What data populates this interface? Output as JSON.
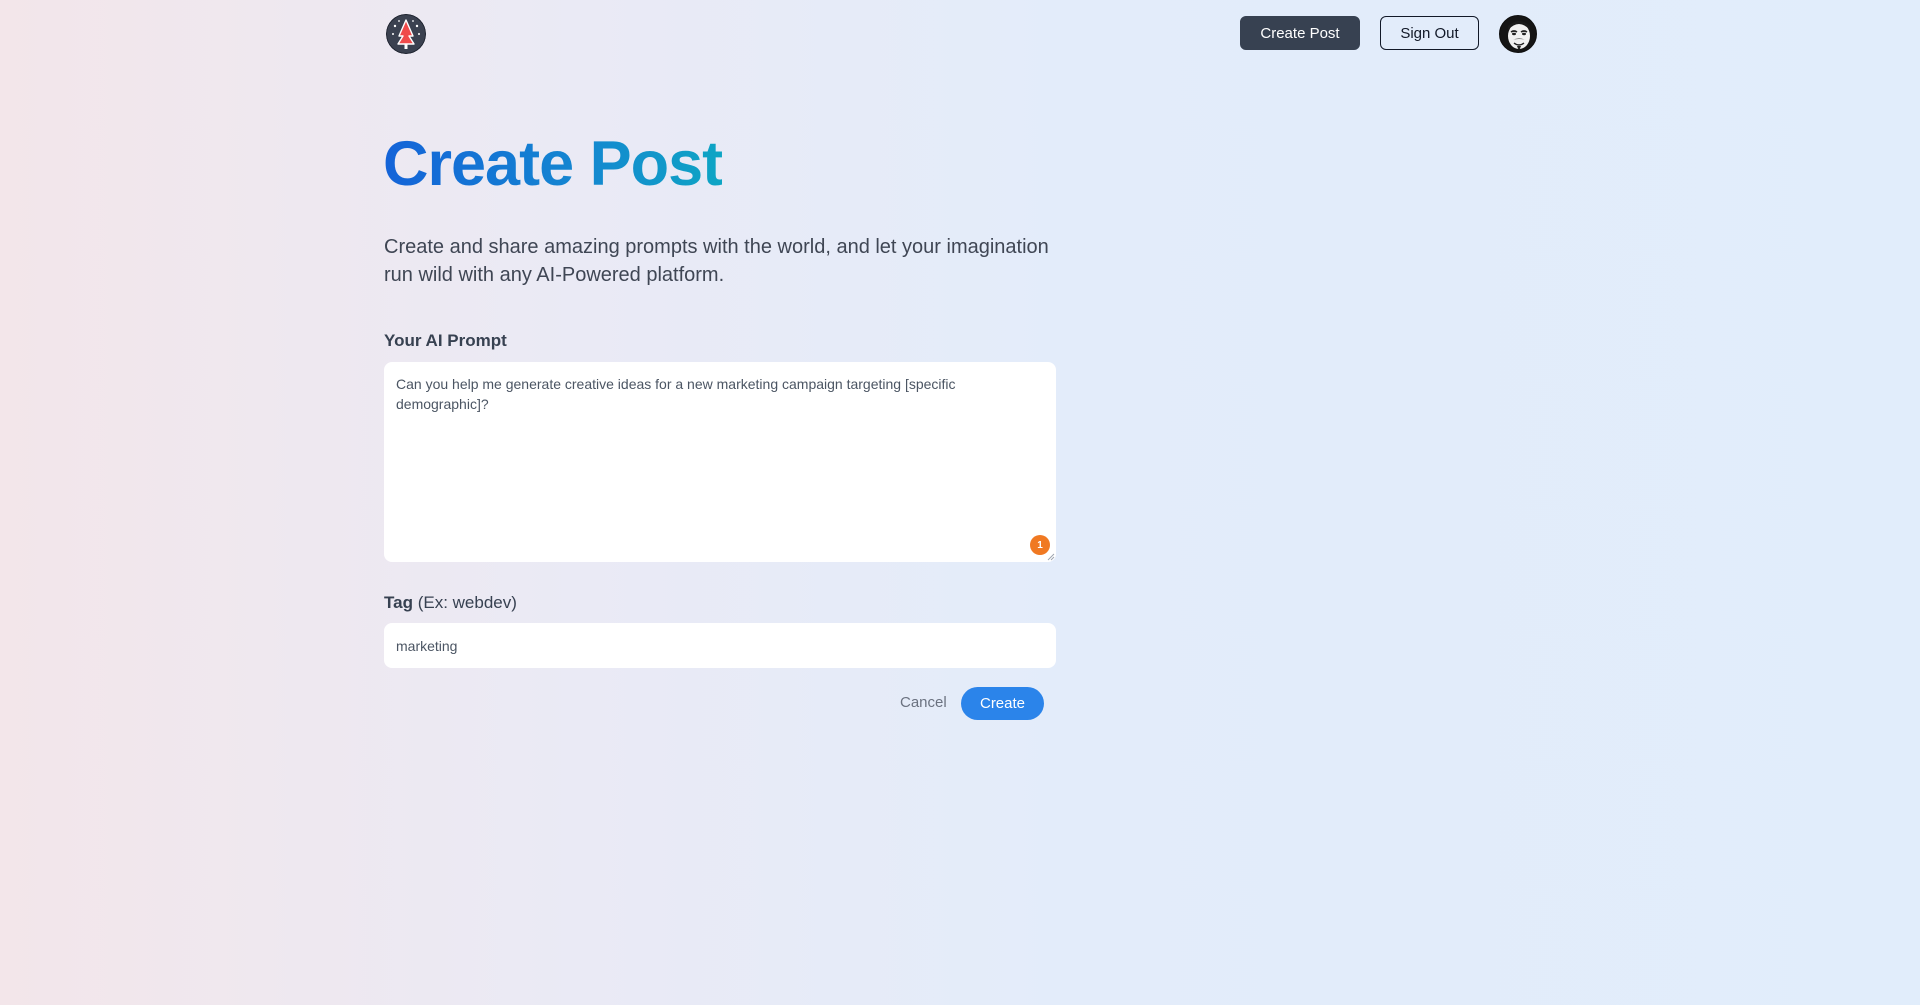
{
  "nav": {
    "create_post_label": "Create Post",
    "sign_out_label": "Sign Out"
  },
  "page": {
    "title": "Create Post",
    "description": "Create and share amazing prompts with the world, and let your imagination run wild with any AI-Powered platform."
  },
  "form": {
    "prompt_label": "Your AI Prompt",
    "prompt_value": "Can you help me generate creative ideas for a new marketing campaign targeting [specific demographic]?",
    "prompt_badge_count": "1",
    "tag_label": "Tag",
    "tag_hint": "(Ex: webdev)",
    "tag_value": "marketing",
    "cancel_label": "Cancel",
    "submit_label": "Create"
  },
  "colors": {
    "title_gradient_start": "#1463d8",
    "title_gradient_end": "#0ea5c4",
    "primary_button": "#2b84ea",
    "dark_button": "#374151",
    "badge": "#f07922"
  },
  "icons": {
    "logo": "logo-icon",
    "avatar": "user-avatar-icon"
  }
}
